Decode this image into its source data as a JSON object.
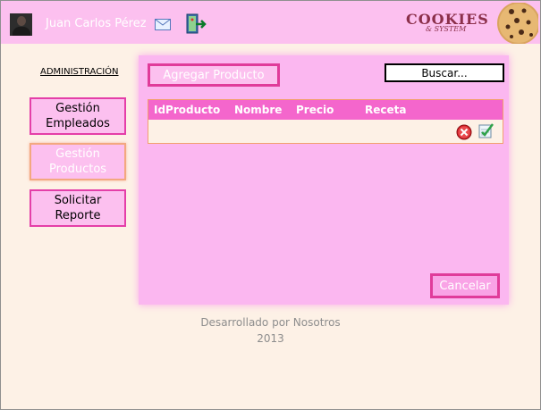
{
  "header": {
    "username": "Juan Carlos Pérez",
    "logo_main": "COOKIES",
    "logo_sub": "& SYSTEM"
  },
  "sidebar": {
    "title": "ADMINISTRACIÓN",
    "items": [
      {
        "label": "Gestión Empleados",
        "active": false
      },
      {
        "label": "Gestión Productos",
        "active": true
      },
      {
        "label": "Solicitar Reporte",
        "active": false
      }
    ]
  },
  "main": {
    "add_button": "Agregar Producto",
    "search_placeholder": "Buscar...",
    "table": {
      "columns": [
        "IdProducto",
        "Nombre",
        "Precio",
        "Receta"
      ],
      "rows": [
        [
          "",
          "",
          "",
          ""
        ]
      ]
    },
    "cancel_button": "Cancelar"
  },
  "footer": {
    "line1": "Desarrollado por Nosotros",
    "line2": "2013"
  },
  "colors": {
    "header_bg": "#fcc0ef",
    "panel_bg": "#fbb7f0",
    "table_header": "#f466cc",
    "button_border": "#e03b9a",
    "page_bg": "#fdf1e6"
  },
  "icons": [
    "avatar",
    "mail-icon",
    "exit-icon",
    "cookie-icon",
    "delete-icon",
    "edit-icon"
  ]
}
